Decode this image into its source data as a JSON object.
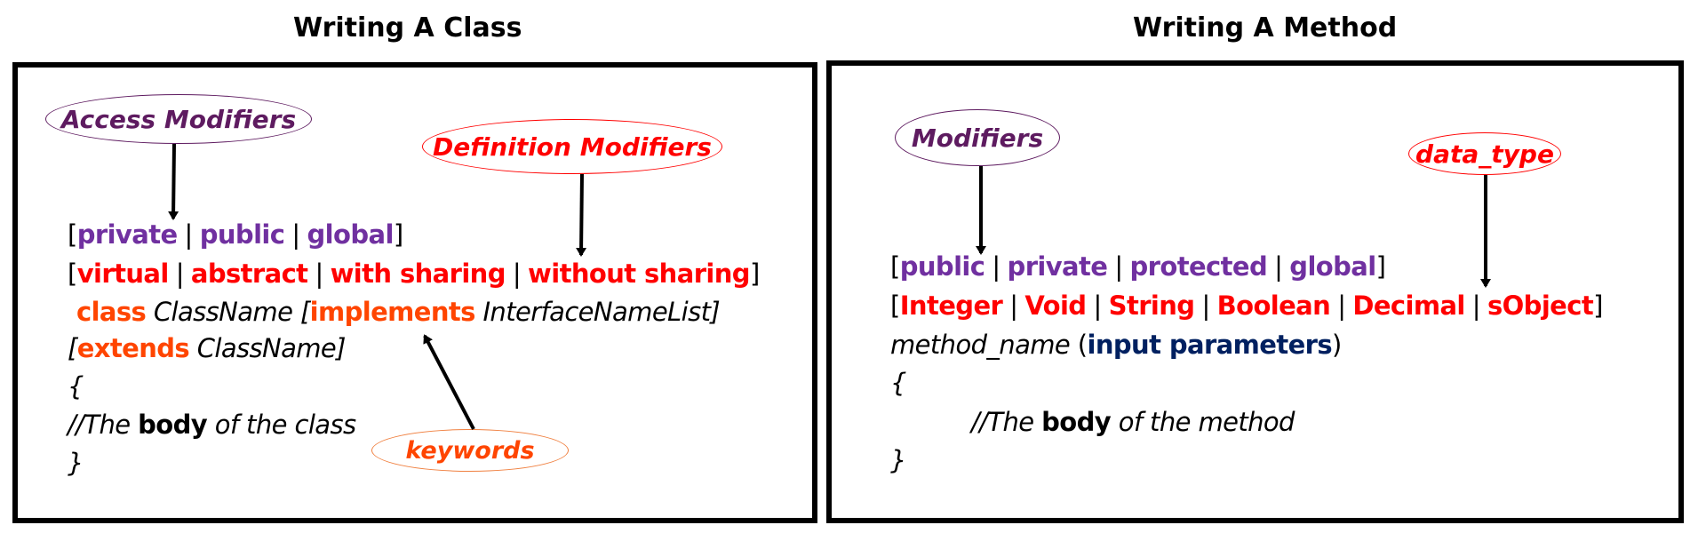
{
  "colors": {
    "access_modifier": "#7030A0",
    "definition_modifier": "#FF0000",
    "keyword": "#FF4500",
    "label_purple": "#5E1B60",
    "parameter": "#002060"
  },
  "class_panel": {
    "title": "Writing A Class",
    "callouts": {
      "access_modifiers": "Access Modifiers",
      "definition_modifiers": "Definition Modifiers",
      "keywords": "keywords"
    },
    "access_modifiers": [
      "private",
      "public",
      "global"
    ],
    "definition_modifiers": [
      "virtual",
      "abstract",
      "with sharing",
      "without sharing"
    ],
    "class_line": {
      "keyword": "class",
      "class_name": "ClassName",
      "implements_keyword": "implements",
      "interface_list": "InterfaceNameList"
    },
    "extends_line": {
      "keyword": "extends",
      "class_name": "ClassName"
    },
    "open_brace": "{",
    "body_comment": {
      "prefix": "//The",
      "emphasis": "body",
      "suffix": "of the class"
    },
    "close_brace": "}"
  },
  "method_panel": {
    "title": "Writing A Method",
    "callouts": {
      "modifiers": "Modifiers",
      "data_type": "data_type"
    },
    "modifiers": [
      "public",
      "private",
      "protected",
      "global"
    ],
    "data_types": [
      "Integer",
      "Void",
      "String",
      "Boolean",
      "Decimal",
      "sObject"
    ],
    "signature": {
      "method_name": "method_name",
      "parameters": "input parameters"
    },
    "open_brace": "{",
    "body_comment": {
      "prefix": "//The",
      "emphasis": "body",
      "suffix": "of the method"
    },
    "close_brace": "}"
  }
}
